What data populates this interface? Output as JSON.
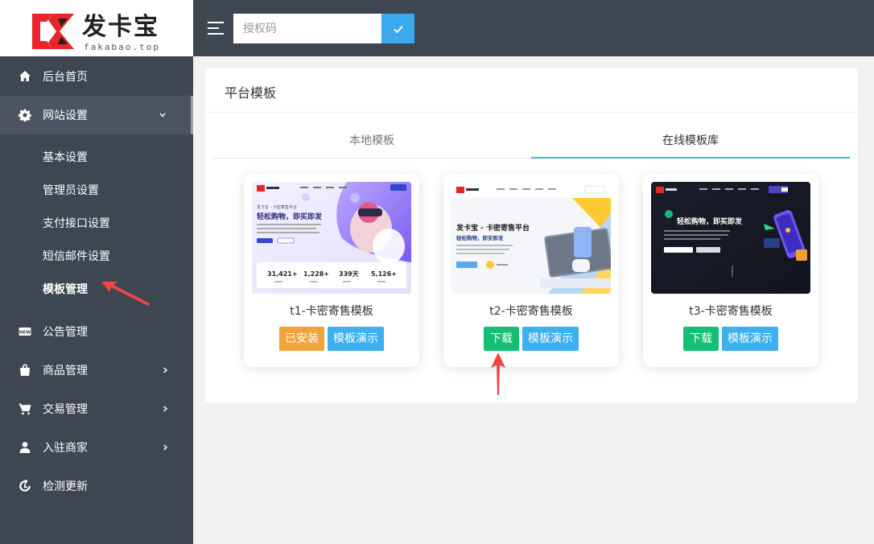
{
  "logo": {
    "name": "发卡宝",
    "domain": "fakabao.top"
  },
  "header": {
    "auth_placeholder": "授权码"
  },
  "sidebar": {
    "items": [
      {
        "label": "后台首页",
        "icon": "home-icon"
      },
      {
        "label": "网站设置",
        "icon": "gear-icon"
      },
      {
        "label": "公告管理",
        "icon": "news-icon"
      },
      {
        "label": "商品管理",
        "icon": "bag-icon"
      },
      {
        "label": "交易管理",
        "icon": "cart-icon"
      },
      {
        "label": "入驻商家",
        "icon": "user-icon"
      },
      {
        "label": "检测更新",
        "icon": "refresh-icon"
      }
    ],
    "sub_items": [
      {
        "label": "基本设置"
      },
      {
        "label": "管理员设置"
      },
      {
        "label": "支付接口设置"
      },
      {
        "label": "短信邮件设置"
      },
      {
        "label": "模板管理"
      }
    ]
  },
  "main": {
    "title": "平台模板",
    "tabs": [
      {
        "label": "本地模板"
      },
      {
        "label": "在线模板库"
      }
    ],
    "templates": [
      {
        "name": "t1-卡密寄售模板",
        "primary_btn": "已安装",
        "demo_btn": "模板演示",
        "preview": {
          "headline": "轻松购物，即买即发",
          "tagline": "发卡宝 - 卡密寄售平台",
          "stats": [
            "31,421+",
            "1,228+",
            "339天",
            "5,126+"
          ]
        }
      },
      {
        "name": "t2-卡密寄售模板",
        "primary_btn": "下载",
        "demo_btn": "模板演示",
        "preview": {
          "headline": "发卡宝 - 卡密寄售平台",
          "tagline": "轻松购物，即买即发"
        }
      },
      {
        "name": "t3-卡密寄售模板",
        "primary_btn": "下载",
        "demo_btn": "模板演示",
        "preview": {
          "headline": "轻松购物，即买即发"
        }
      }
    ]
  },
  "colors": {
    "sidebar_bg": "#3e4652",
    "tab_active": "#35c0b0",
    "installed": "#f2a33a",
    "download": "#13c073",
    "demo": "#3db0ef",
    "annotation": "#f04545"
  }
}
